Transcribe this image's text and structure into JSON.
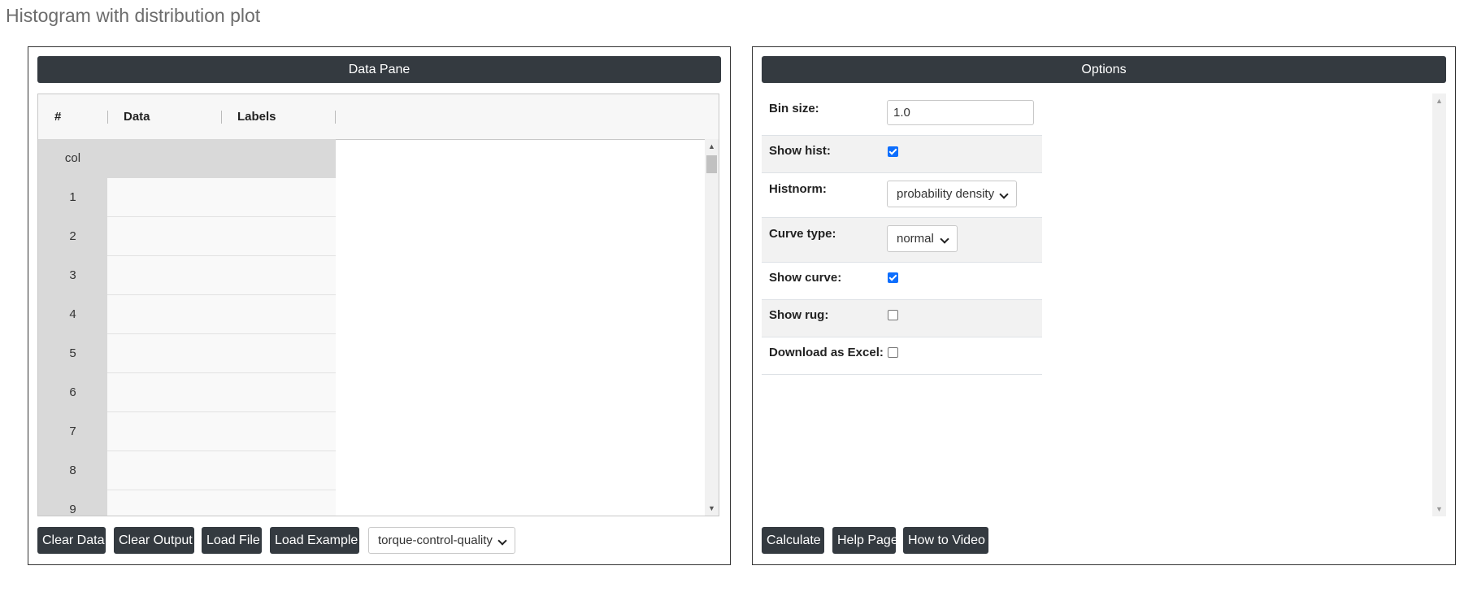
{
  "page": {
    "title": "Histogram with distribution plot"
  },
  "data_pane": {
    "header": "Data Pane",
    "columns": [
      "#",
      "Data",
      "Labels"
    ],
    "col_row_label": "col",
    "row_numbers": [
      "1",
      "2",
      "3",
      "4",
      "5",
      "6",
      "7",
      "8",
      "9"
    ],
    "buttons": {
      "clear_data": "Clear Data",
      "clear_output": "Clear Output",
      "load_file": "Load File",
      "load_example": "Load Example"
    },
    "example_select": {
      "value": "torque-control-quality"
    }
  },
  "options": {
    "header": "Options",
    "bin_size": {
      "label": "Bin size:",
      "value": "1.0"
    },
    "show_hist": {
      "label": "Show hist:",
      "checked": true
    },
    "histnorm": {
      "label": "Histnorm:",
      "value": "probability density"
    },
    "curve_type": {
      "label": "Curve type:",
      "value": "normal"
    },
    "show_curve": {
      "label": "Show curve:",
      "checked": true
    },
    "show_rug": {
      "label": "Show rug:",
      "checked": false
    },
    "download_excel": {
      "label": "Download as Excel:",
      "checked": false
    },
    "buttons": {
      "calculate": "Calculate",
      "help_page": "Help Page",
      "how_to_video": "How to Video"
    }
  },
  "icons": {
    "scroll_up": "▲",
    "scroll_down": "▼"
  },
  "colors": {
    "button_bg": "#343a40",
    "checkbox_checked": "#0d6efd",
    "title_text": "#6c6c6c"
  }
}
